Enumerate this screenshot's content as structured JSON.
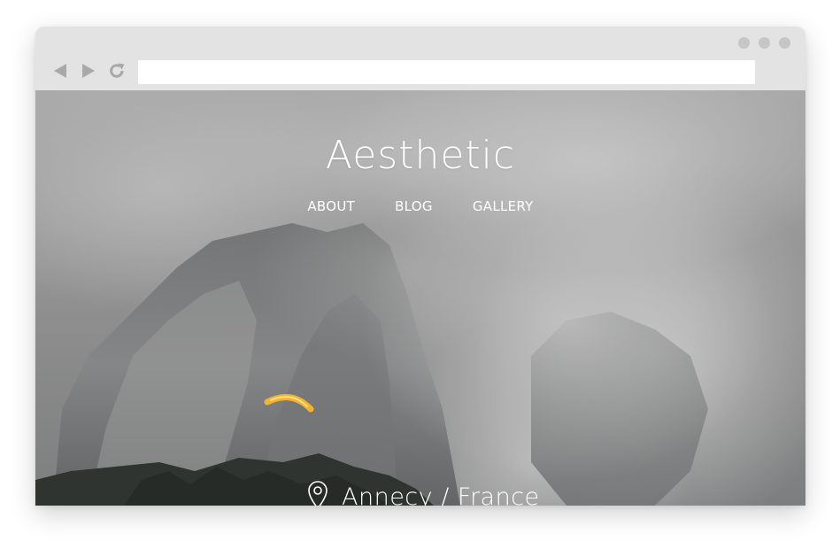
{
  "browser": {
    "url": "",
    "icons": {
      "back": "back-arrow-icon",
      "forward": "forward-arrow-icon",
      "reload": "reload-icon",
      "window_controls": "window-dots-icon"
    }
  },
  "site": {
    "title": "Aesthetic",
    "nav": [
      {
        "label": "ABOUT"
      },
      {
        "label": "BLOG"
      },
      {
        "label": "GALLERY"
      }
    ],
    "location": {
      "icon": "location-pin-icon",
      "text": "Annecy / France"
    }
  },
  "colors": {
    "chrome": "#e3e3e3",
    "dots": "#c6c6c6",
    "nav_arrows": "#a8a8a8",
    "text": "#ffffff",
    "paraglider": "#f3b32e"
  }
}
